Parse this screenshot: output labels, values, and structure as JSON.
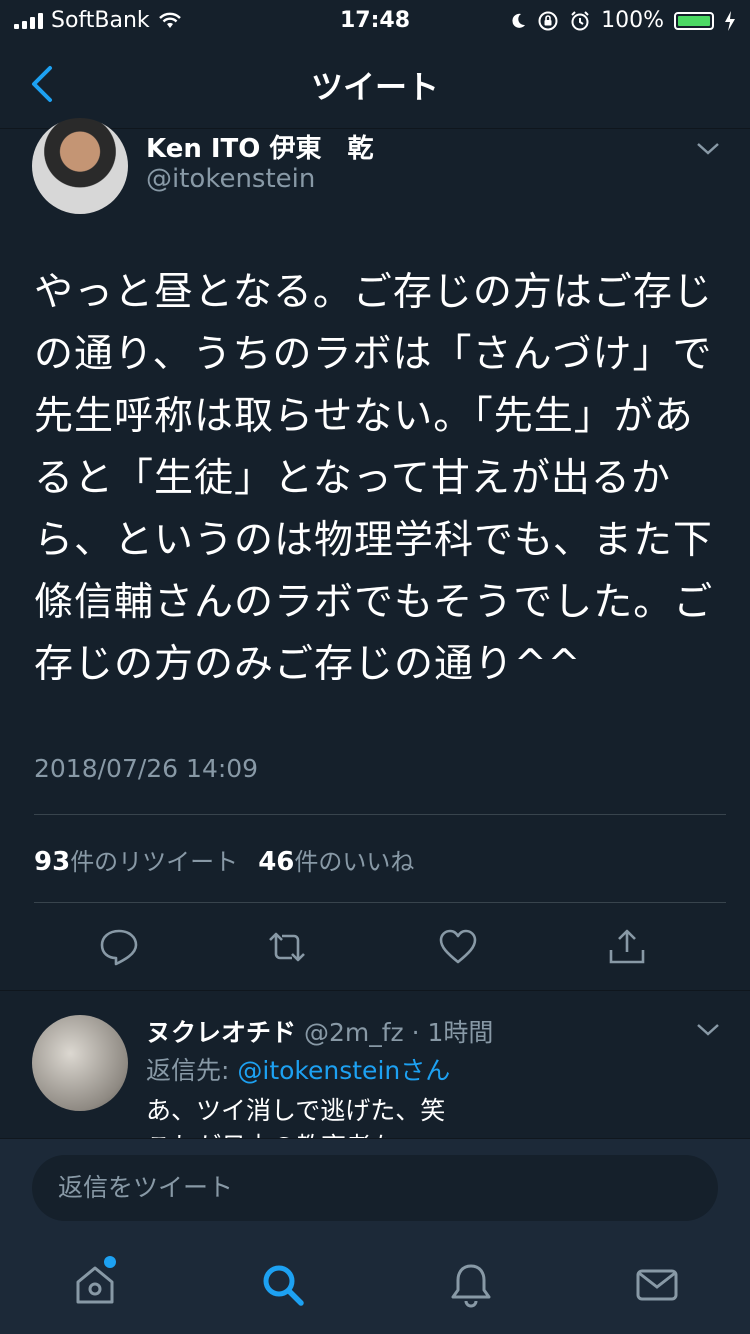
{
  "status_bar": {
    "carrier": "SoftBank",
    "time": "17:48",
    "battery": "100%"
  },
  "nav": {
    "title": "ツイート"
  },
  "tweet": {
    "author_name": "Ken ITO 伊東　乾",
    "author_handle": "@itokenstein",
    "text": "やっと昼となる。ご存じの方はご存じの通り、うちのラボは「さんづけ」で先生呼称は取らせない。「先生」があると「生徒」となって甘えが出るから、というのは物理学科でも、また下條信輔さんのラボでもそうでした。ご存じの方のみご存じの通り^^",
    "timestamp": "2018/07/26 14:09",
    "retweet_count": "93",
    "retweet_label": "件のリツイート",
    "like_count": "46",
    "like_label": "件のいいね"
  },
  "reply": {
    "name": "ヌクレオチド",
    "handle": "@2m_fz",
    "time": "· 1時間",
    "reply_to_label": "返信先: ",
    "reply_to_user": "@itokensteinさん",
    "text": "あ、ツイ消しで逃げた、笑\nこれが日本の教育者な"
  },
  "composer": {
    "placeholder": "返信をツイート"
  },
  "colors": {
    "background": "#15202b",
    "accent": "#1da1f2",
    "secondary_text": "#8899a6",
    "battery": "#4cd964"
  },
  "icons": [
    "back-chevron-icon",
    "chevron-down-icon",
    "reply-icon",
    "retweet-icon",
    "like-icon",
    "share-icon",
    "home-icon",
    "search-icon",
    "notifications-icon",
    "messages-icon"
  ]
}
